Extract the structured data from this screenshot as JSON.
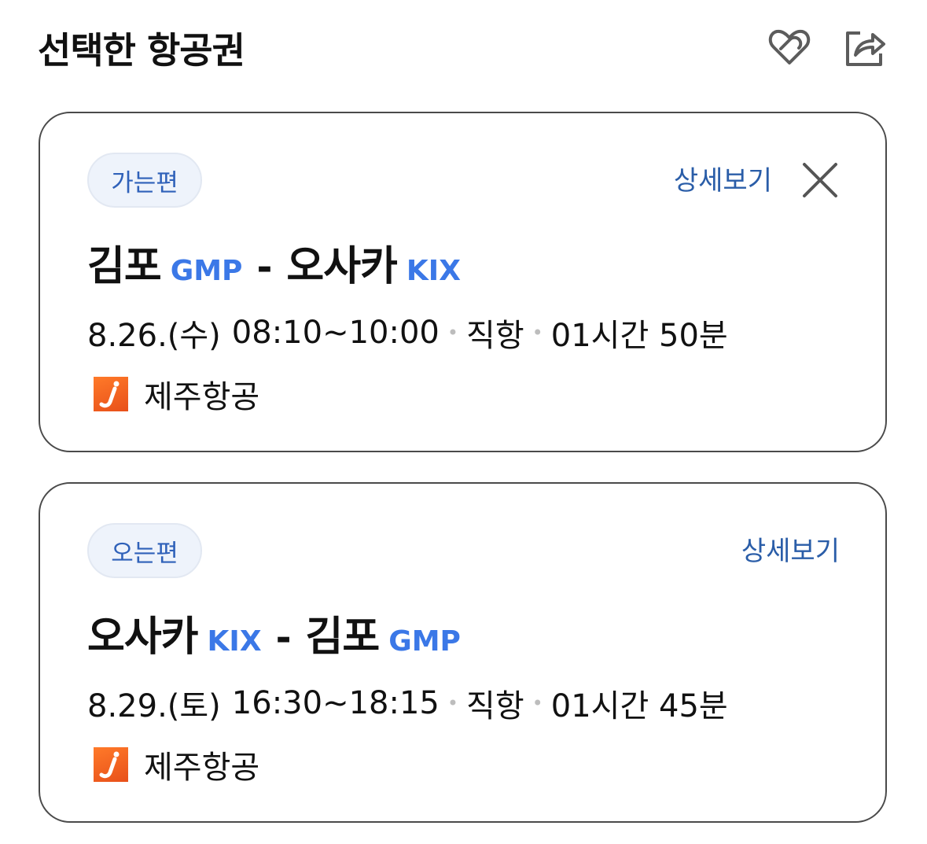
{
  "header": {
    "title": "선택한 항공권",
    "like_icon": "heart-outline-icon",
    "share_icon": "share-icon"
  },
  "outbound": {
    "badge": "가는편",
    "detail_link": "상세보기",
    "close_icon": "close-icon",
    "origin_city": "김포",
    "origin_code": "GMP",
    "route_separator": "-",
    "destination_city": "오사카",
    "destination_code": "KIX",
    "date": "8.26.(수)",
    "time": "08:10~10:00",
    "dot": "•",
    "flight_type": "직항",
    "duration": "01시간 50분",
    "airline_name": "제주항공",
    "airline_logo": "jeju-air-logo"
  },
  "inbound": {
    "badge": "오는편",
    "detail_link": "상세보기",
    "origin_city": "오사카",
    "origin_code": "KIX",
    "route_separator": "-",
    "destination_city": "김포",
    "destination_code": "GMP",
    "date": "8.29.(토)",
    "time": "16:30~18:15",
    "dot": "•",
    "flight_type": "직항",
    "duration": "01시간 45분",
    "airline_name": "제주항공",
    "airline_logo": "jeju-air-logo"
  },
  "colors": {
    "accent_blue": "#3b78e7",
    "link_blue": "#2a5da8",
    "badge_bg": "#eef3fb",
    "card_border": "#4a4a4a",
    "airline_orange": "#e8501a"
  }
}
